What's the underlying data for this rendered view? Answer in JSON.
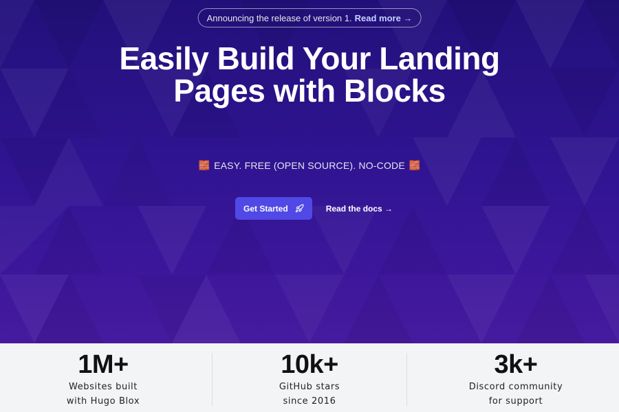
{
  "announcement": {
    "text": "Announcing the release of version 1.",
    "link_label": "Read more →"
  },
  "hero": {
    "title": "Easily Build Your Landing Pages with Blocks",
    "tagline": "EASY. FREE (OPEN SOURCE). NO-CODE",
    "tagline_icon": "🧱",
    "primary_button_label": "Get Started",
    "primary_button_icon": "rocket-icon",
    "secondary_link_label": "Read the docs →"
  },
  "stats": [
    {
      "value": "1M+",
      "label_line1": "Websites built",
      "label_line2": "with Hugo Blox"
    },
    {
      "value": "10k+",
      "label_line1": "GitHub stars",
      "label_line2": "since 2016"
    },
    {
      "value": "3k+",
      "label_line1": "Discord community",
      "label_line2": "for support"
    }
  ],
  "colors": {
    "hero_background": "#2e1490",
    "primary_button": "#5049e6",
    "announce_link": "#c7d2fe",
    "stats_background": "#f3f4f6"
  }
}
